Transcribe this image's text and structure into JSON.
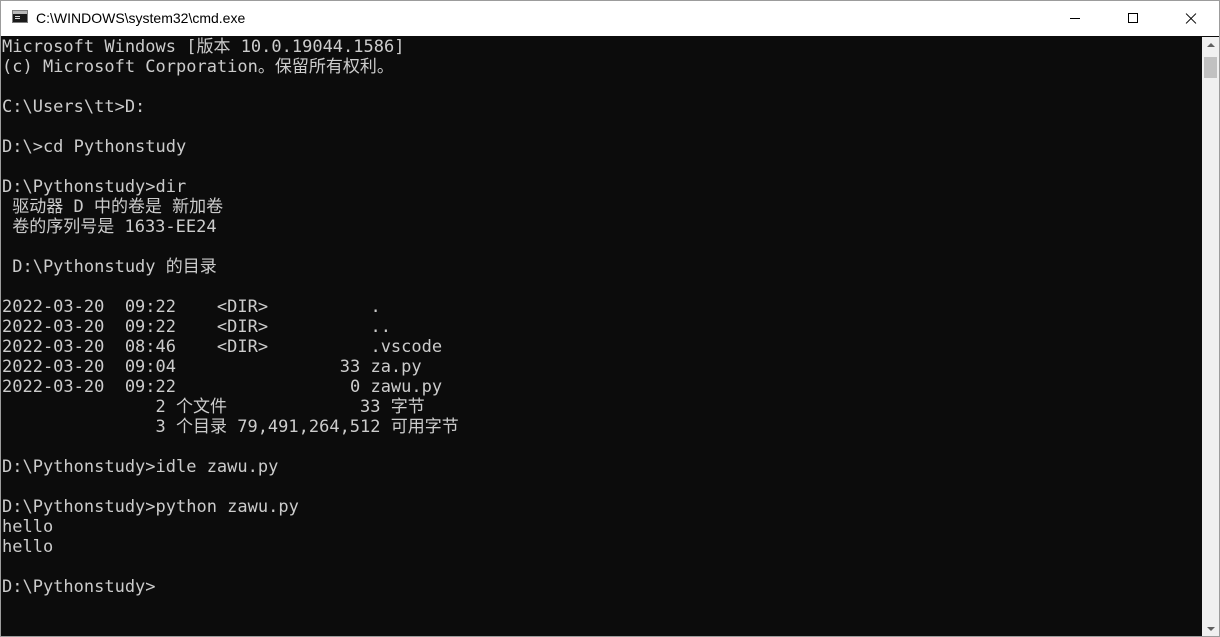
{
  "window": {
    "title": "C:\\WINDOWS\\system32\\cmd.exe",
    "icon": "console-app-icon",
    "controls": {
      "minimize": "minimize-icon",
      "maximize": "maximize-icon",
      "close": "close-icon"
    }
  },
  "colors": {
    "console_background": "#0c0c0c",
    "console_text": "#cccccc",
    "titlebar_background": "#ffffff"
  },
  "console": {
    "lines": [
      "Microsoft Windows [版本 10.0.19044.1586]",
      "(c) Microsoft Corporation。保留所有权利。",
      "",
      "C:\\Users\\tt>D:",
      "",
      "D:\\>cd Pythonstudy",
      "",
      "D:\\Pythonstudy>dir",
      " 驱动器 D 中的卷是 新加卷",
      " 卷的序列号是 1633-EE24",
      "",
      " D:\\Pythonstudy 的目录",
      "",
      "2022-03-20  09:22    <DIR>          .",
      "2022-03-20  09:22    <DIR>          ..",
      "2022-03-20  08:46    <DIR>          .vscode",
      "2022-03-20  09:04                33 za.py",
      "2022-03-20  09:22                 0 zawu.py",
      "               2 个文件             33 字节",
      "               3 个目录 79,491,264,512 可用字节",
      "",
      "D:\\Pythonstudy>idle zawu.py",
      "",
      "D:\\Pythonstudy>python zawu.py",
      "hello",
      "hello",
      "",
      "D:\\Pythonstudy>"
    ]
  },
  "scrollbar": {
    "up_icon": "scroll-up-arrow-icon",
    "down_icon": "scroll-down-arrow-icon"
  }
}
